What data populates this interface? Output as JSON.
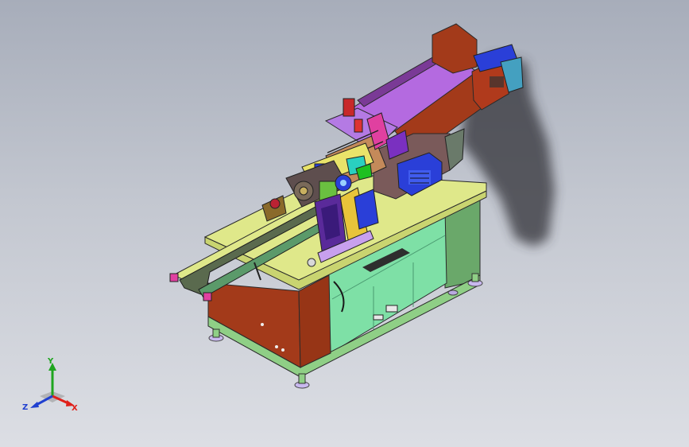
{
  "viewport": {
    "background_top": "#a7adba",
    "background_bottom": "#dcdee4"
  },
  "triad": {
    "x_label": "X",
    "y_label": "Y",
    "z_label": "Z",
    "x_color": "#e0201a",
    "y_color": "#1fa51f",
    "z_color": "#2040d0"
  },
  "model": {
    "icon": "cad-assembly-icon",
    "colors": {
      "table_top": "#dfe88a",
      "cabinet_green": "#8fcf86",
      "cabinet_open": "#7ee0a6",
      "brown_panel": "#a33a1a",
      "purple_beam": "#b46ae0",
      "blue_box": "#2a3fd8",
      "yellow_post": "#e8c43a",
      "shadow": "#3a3a3c"
    }
  }
}
